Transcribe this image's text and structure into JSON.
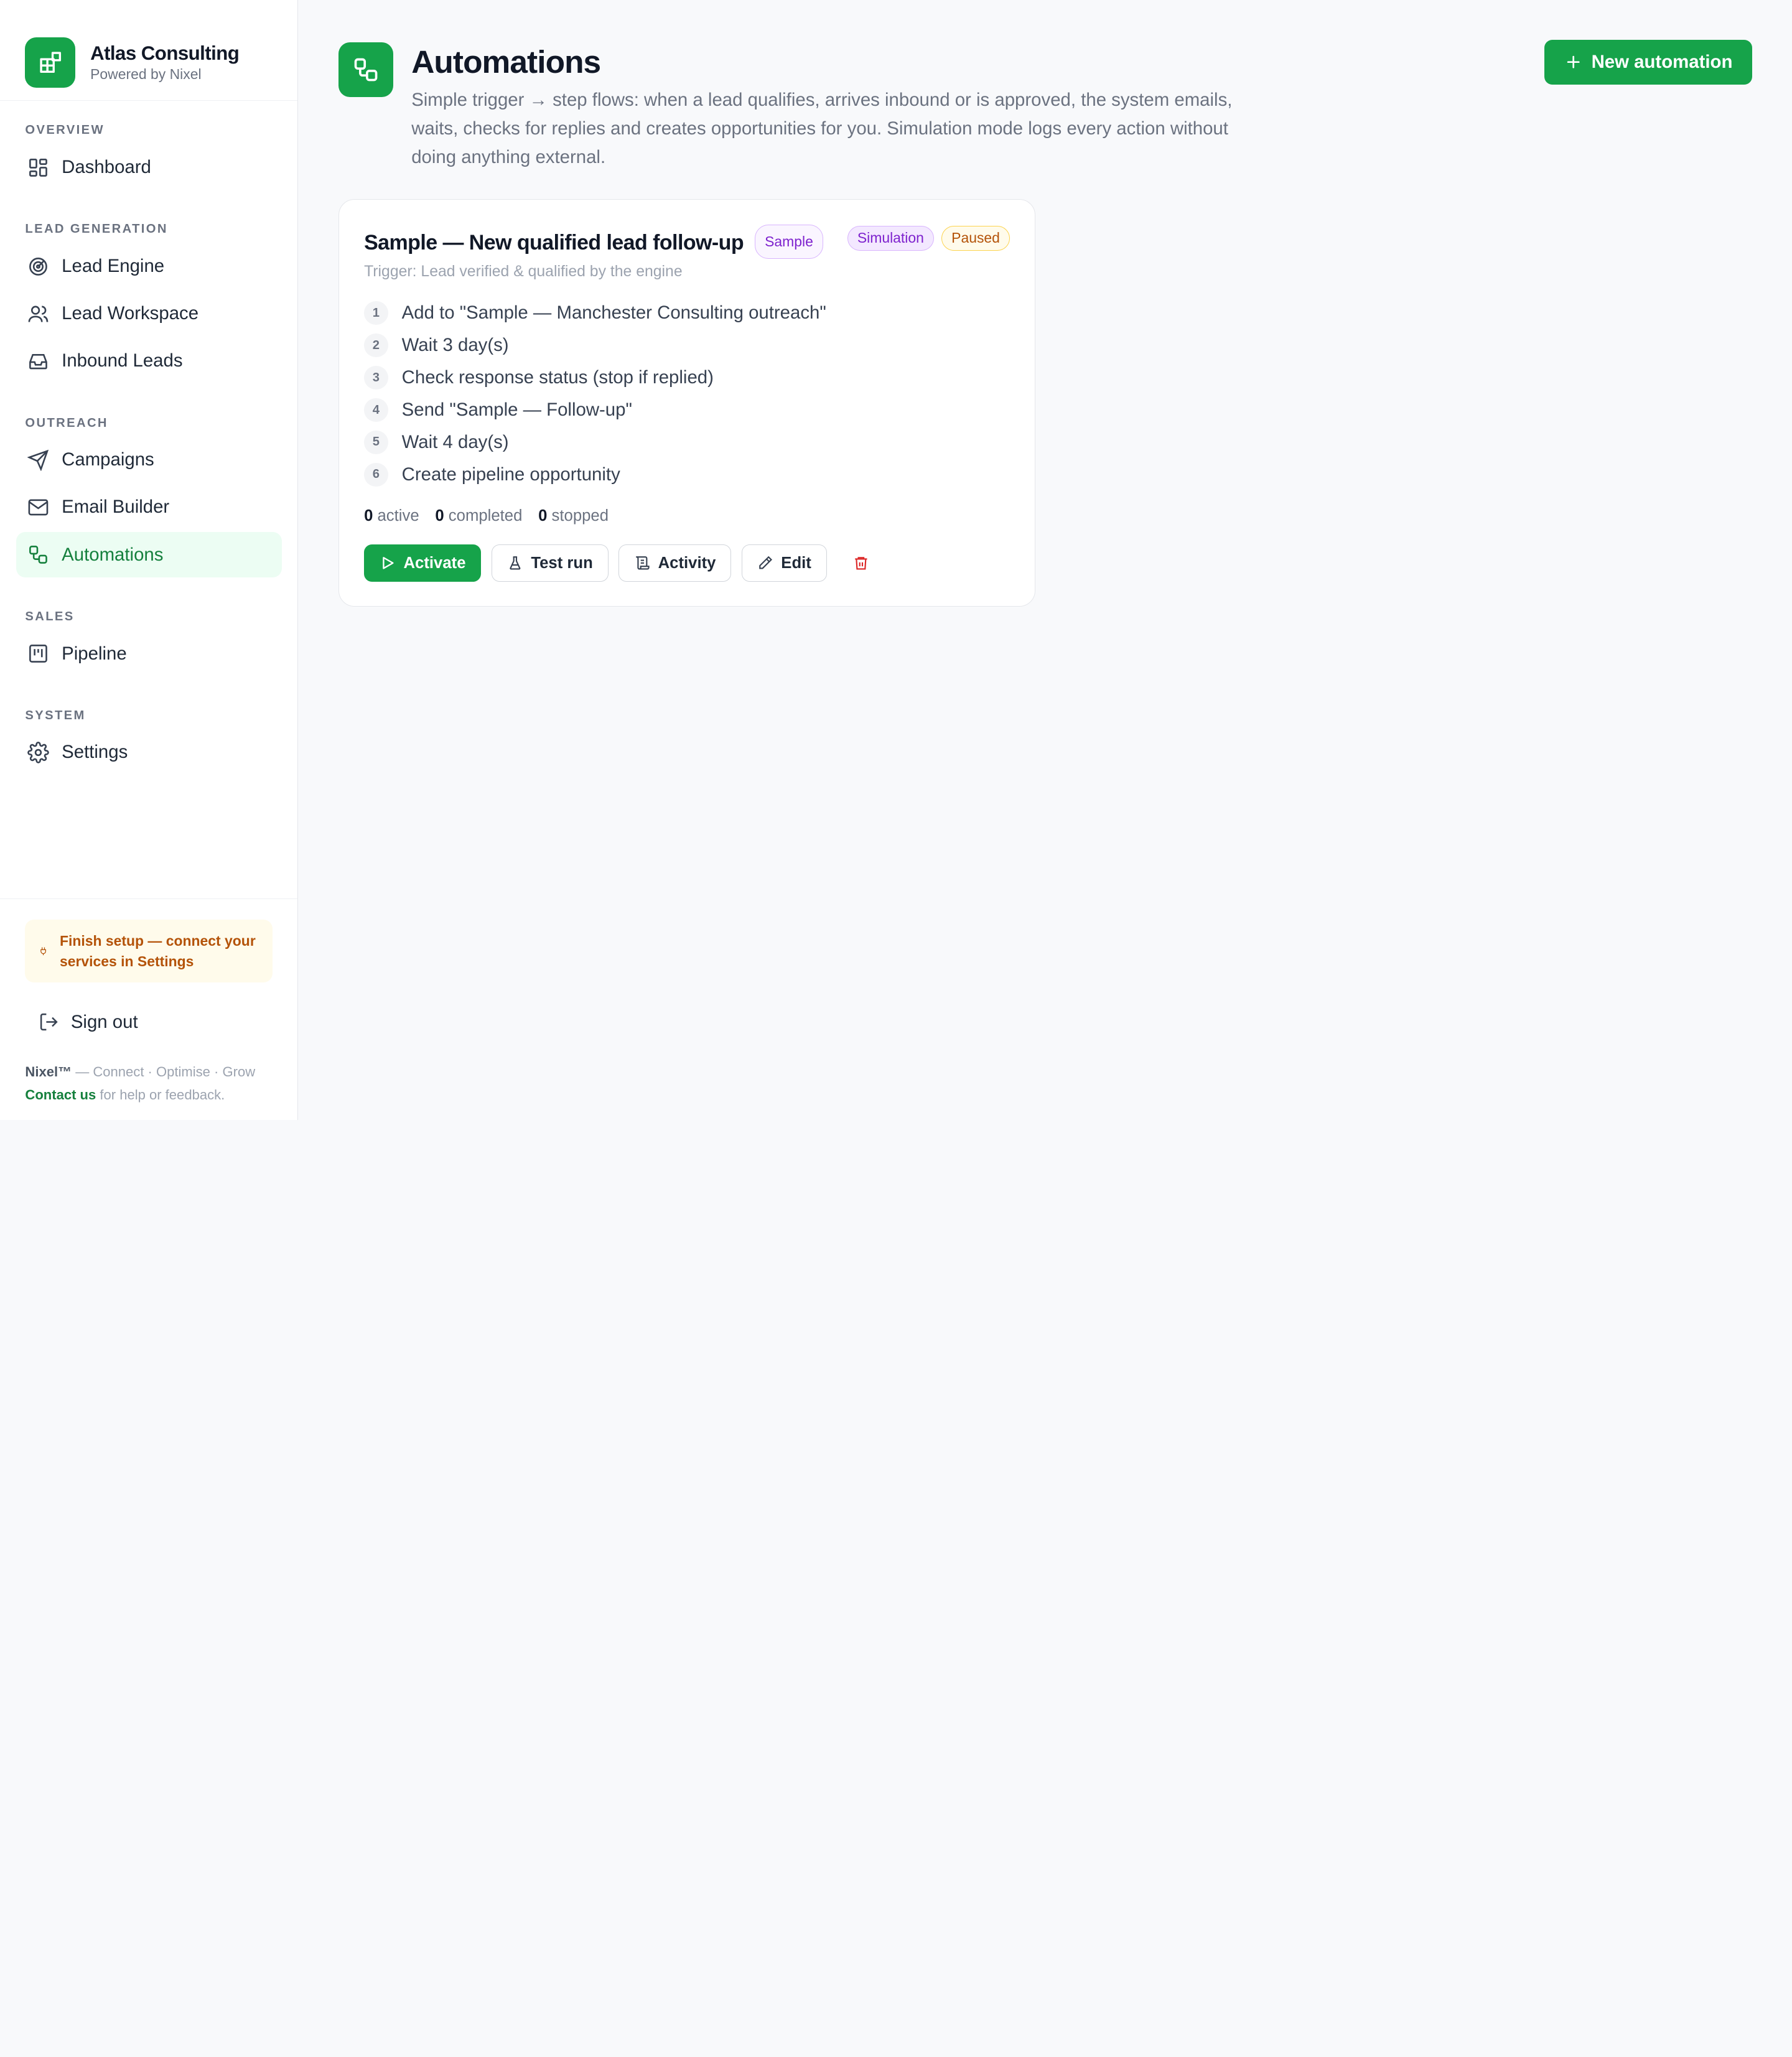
{
  "brand": {
    "name": "Atlas Consulting",
    "subtitle": "Powered by Nixel"
  },
  "nav": {
    "sections": {
      "overview": "OVERVIEW",
      "lead_generation": "LEAD GENERATION",
      "outreach": "OUTREACH",
      "sales": "SALES",
      "system": "SYSTEM"
    },
    "items": {
      "dashboard": "Dashboard",
      "lead_engine": "Lead Engine",
      "lead_workspace": "Lead Workspace",
      "inbound_leads": "Inbound Leads",
      "campaigns": "Campaigns",
      "email_builder": "Email Builder",
      "automations": "Automations",
      "pipeline": "Pipeline",
      "settings": "Settings"
    },
    "active": "automations"
  },
  "sidebar_bottom": {
    "setup_notice": "Finish setup — connect your services in Settings",
    "sign_out": "Sign out",
    "footer_brand": "Nixel™",
    "footer_tagline": " — Connect · Optimise · Grow",
    "contact_link": "Contact us",
    "contact_suffix": " for help or feedback."
  },
  "page": {
    "title": "Automations",
    "description": "Simple trigger → step flows: when a lead qualifies, arrives inbound or is approved, the system emails, waits, checks for replies and creates opportunities for you. Simulation mode logs every action without doing anything external.",
    "new_button": "New automation"
  },
  "automation": {
    "title": "Sample — New qualified lead follow-up",
    "badge_sample": "Sample",
    "badge_mode": "Simulation",
    "badge_status": "Paused",
    "trigger": "Trigger: Lead verified & qualified by the engine",
    "steps": [
      {
        "num": "1",
        "text": "Add to \"Sample — Manchester Consulting outreach\""
      },
      {
        "num": "2",
        "text": "Wait 3 day(s)"
      },
      {
        "num": "3",
        "text": "Check response status (stop if replied)"
      },
      {
        "num": "4",
        "text": "Send \"Sample — Follow-up\""
      },
      {
        "num": "5",
        "text": "Wait 4 day(s)"
      },
      {
        "num": "6",
        "text": "Create pipeline opportunity"
      }
    ],
    "stats": {
      "active_count": "0",
      "active_label": " active",
      "completed_count": "0",
      "completed_label": " completed",
      "stopped_count": "0",
      "stopped_label": " stopped"
    },
    "actions": {
      "activate": "Activate",
      "test_run": "Test run",
      "activity": "Activity",
      "edit": "Edit"
    }
  },
  "colors": {
    "accent": "#16a34a",
    "accent_light": "#ecfdf3",
    "danger": "#dc2626",
    "warning": "#b45309",
    "purple": "#7e22ce"
  }
}
